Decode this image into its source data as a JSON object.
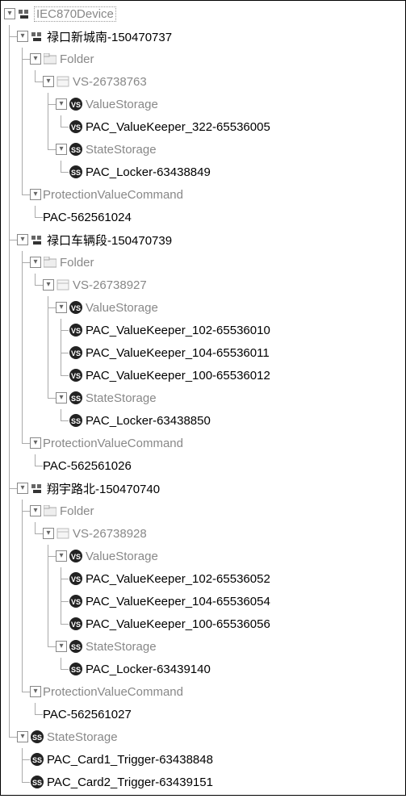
{
  "root": {
    "label": "IEC870Device",
    "icon": "device-icon",
    "selected": true,
    "gray": true
  },
  "stations": [
    {
      "label": "禄口新城南-150470737",
      "icon": "device-icon",
      "folder_label": "Folder",
      "vs_label": "VS-26738763",
      "value_storage_label": "ValueStorage",
      "value_storage_icon": "vs-icon",
      "value_keepers": [
        "PAC_ValueKeeper_322-65536005"
      ],
      "state_storage_label": "StateStorage",
      "state_storage_icon": "ss-icon",
      "lockers": [
        "PAC_Locker-63438849"
      ],
      "pvc_label": "ProtectionValueCommand",
      "pacs": [
        "PAC-562561024"
      ]
    },
    {
      "label": "禄口车辆段-150470739",
      "icon": "device-icon",
      "folder_label": "Folder",
      "vs_label": "VS-26738927",
      "value_storage_label": "ValueStorage",
      "value_storage_icon": "vs-icon",
      "value_keepers": [
        "PAC_ValueKeeper_102-65536010",
        "PAC_ValueKeeper_104-65536011",
        "PAC_ValueKeeper_100-65536012"
      ],
      "state_storage_label": "StateStorage",
      "state_storage_icon": "ss-icon",
      "lockers": [
        "PAC_Locker-63438850"
      ],
      "pvc_label": "ProtectionValueCommand",
      "pacs": [
        "PAC-562561026"
      ]
    },
    {
      "label": "翔宇路北-150470740",
      "icon": "device-icon",
      "folder_label": "Folder",
      "vs_label": "VS-26738928",
      "value_storage_label": "ValueStorage",
      "value_storage_icon": "vs-icon",
      "value_keepers": [
        "PAC_ValueKeeper_102-65536052",
        "PAC_ValueKeeper_104-65536054",
        "PAC_ValueKeeper_100-65536056"
      ],
      "state_storage_label": "StateStorage",
      "state_storage_icon": "ss-icon",
      "lockers": [
        "PAC_Locker-63439140"
      ],
      "pvc_label": "ProtectionValueCommand",
      "pacs": [
        "PAC-562561027"
      ]
    }
  ],
  "root_state_storage": {
    "label": "StateStorage",
    "icon": "ss-icon",
    "items": [
      "PAC_Card1_Trigger-63438848",
      "PAC_Card2_Trigger-63439151"
    ]
  },
  "icons": {
    "device": "device-icon",
    "folder": "folder-icon",
    "box": "box-icon",
    "vs": "vs-icon",
    "ss": "ss-icon"
  }
}
